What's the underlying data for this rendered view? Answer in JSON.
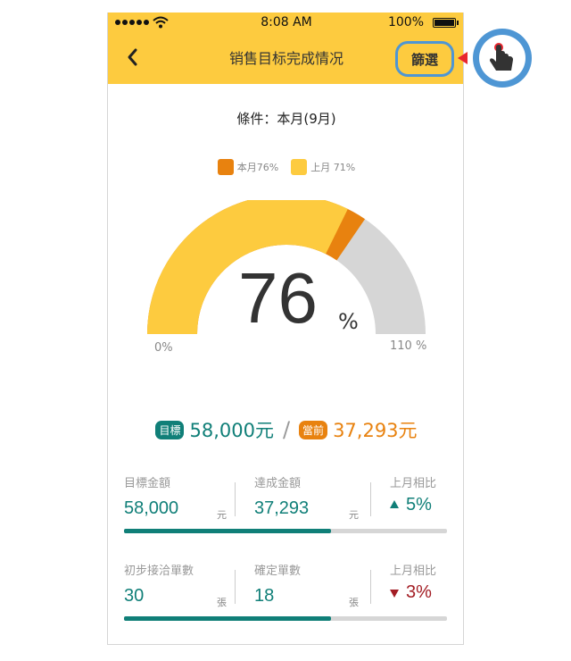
{
  "status_bar": {
    "time": "8:08 AM",
    "battery": "100%"
  },
  "nav": {
    "title": "销售目标完成情况",
    "filter_label": "篩選",
    "back_icon": "chevron-left-icon"
  },
  "condition": "條件：本月(9月)",
  "legend": [
    {
      "label": "本月76%",
      "color": "#e8820f"
    },
    {
      "label": "上月 71%",
      "color": "#fdcb3f"
    }
  ],
  "gauge": {
    "current_percent": 76,
    "last_month_percent": 71,
    "max_percent": 110,
    "value_text": "76",
    "percent_sign": "%",
    "min_label": "0%",
    "max_label": "110 %",
    "colors": {
      "current": "#e8820f",
      "last": "#fdcb3f",
      "track": "#d6d6d6"
    }
  },
  "summary": {
    "target_tag": "目標",
    "target_value": "58,000元",
    "separator": "/",
    "current_tag": "當前",
    "current_value": "37,293元"
  },
  "rows": [
    {
      "label_a": "目標金額",
      "value_a": "58,000",
      "unit_a": "元",
      "label_b": "達成金額",
      "value_b": "37,293",
      "unit_b": "元",
      "label_c": "上月相比",
      "compare": "5%",
      "direction": "up",
      "compare_color": "#107f78",
      "progress": 0.64
    },
    {
      "label_a": "初步接洽單數",
      "value_a": "30",
      "unit_a": "張",
      "label_b": "確定單數",
      "value_b": "18",
      "unit_b": "張",
      "label_c": "上月相比",
      "compare": "3%",
      "direction": "down",
      "compare_color": "#a31d24",
      "progress": 0.64
    }
  ],
  "colors": {
    "header": "#fdcb3f",
    "accent_green": "#107f78",
    "accent_orange": "#e8820f",
    "highlight_blue": "#4e96d4"
  },
  "tap_hint_icon": "hand-pointer-icon"
}
